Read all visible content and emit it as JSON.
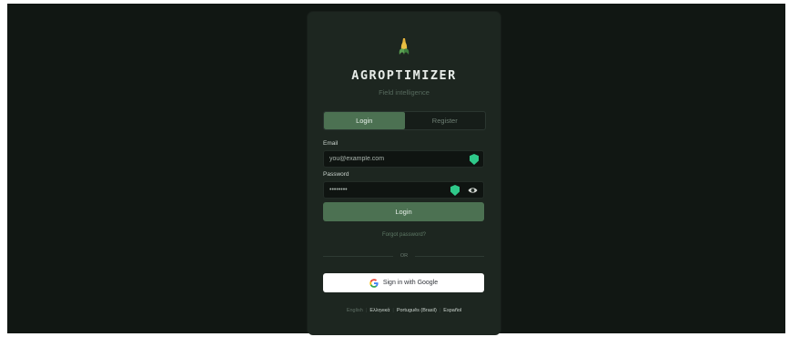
{
  "app": {
    "title": "AGROPTIMIZER",
    "subtitle": "Field intelligence",
    "logo_icon": "corn-icon"
  },
  "tabs": [
    {
      "label": "Login",
      "active": true
    },
    {
      "label": "Register",
      "active": false
    }
  ],
  "form": {
    "email_label": "Email",
    "email_value": "you@example.com",
    "password_label": "Password",
    "password_value": "••••••••",
    "password_manager_icon": "shield-icon",
    "show_password_icon": "eye-icon",
    "submit_label": "Login",
    "forgot_label": "Forgot password?"
  },
  "divider_label": "OR",
  "google": {
    "label": "Sign in with Google",
    "icon": "google-icon"
  },
  "languages": [
    {
      "label": "English",
      "active": true
    },
    {
      "label": "Ελληνικά",
      "active": false
    },
    {
      "label": "Português (Brasil)",
      "active": false
    },
    {
      "label": "Español",
      "active": false
    }
  ],
  "colors": {
    "background": "#111713",
    "card": "#1d2620",
    "accent": "#4c7152",
    "shield": "#2fc98a"
  }
}
